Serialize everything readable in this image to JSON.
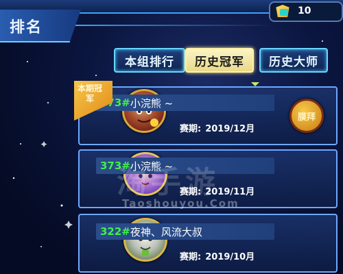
{
  "header": {
    "title": "排名"
  },
  "currency": {
    "icon": "crown-gem-icon",
    "amount": "10"
  },
  "tabs": [
    {
      "label": "本组排行",
      "active": false
    },
    {
      "label": "历史冠军",
      "active": true
    },
    {
      "label": "历史大师",
      "active": false
    }
  ],
  "badge": {
    "label": "本期冠军"
  },
  "champions": [
    {
      "rank": "373#",
      "name": "小浣熊 ~",
      "season_label": "赛期:",
      "season": "2019/12月",
      "avatar_icon": "pirate-character-avatar"
    },
    {
      "rank": "373#",
      "name": "小浣熊 ~",
      "season_label": "赛期:",
      "season": "2019/11月",
      "avatar_icon": "purple-hair-character-avatar"
    },
    {
      "rank": "322#",
      "name": "夜神、风流大叔",
      "season_label": "赛期:",
      "season": "2019/10月",
      "avatar_icon": "white-tiger-character-avatar"
    }
  ],
  "action": {
    "label": "膜拜"
  },
  "watermark": {
    "text": "淘手游",
    "url": "Taoshouyou.Com"
  },
  "colors": {
    "rank_green": "#3ff04a",
    "active_tab": "#f3e9a8",
    "accent_blue": "#66d8ff",
    "gold": "#f3a21a"
  }
}
